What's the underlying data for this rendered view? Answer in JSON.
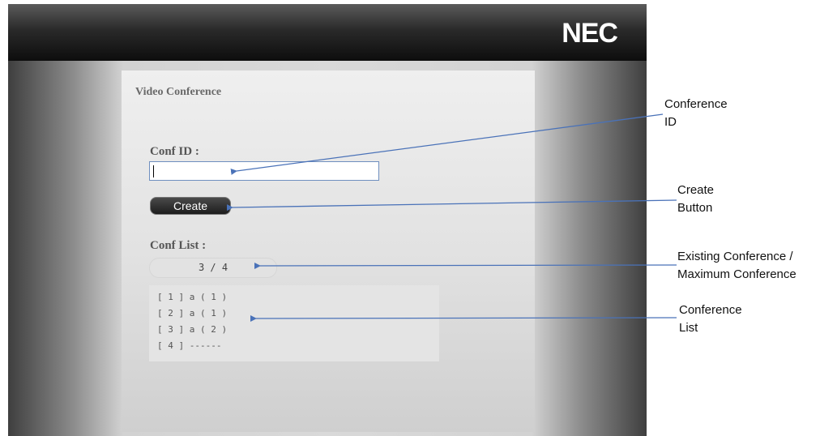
{
  "header": {
    "brand": "NEC"
  },
  "app": {
    "title": "Video Conference",
    "conf_id_label": "Conf ID :",
    "conf_id_value": "",
    "create_button": "Create",
    "conf_list_label": "Conf List :",
    "conf_count": "3 / 4",
    "conferences": [
      "[ 1 ] a ( 1 )",
      "[ 2 ] a ( 1 )",
      "[ 3 ] a ( 2 )",
      "[ 4 ] ------"
    ]
  },
  "annotations": {
    "conference_id": {
      "line1": "Conference",
      "line2": "ID"
    },
    "create_button": {
      "line1": "Create",
      "line2": "Button"
    },
    "count": {
      "line1": "Existing Conference /",
      "line2": "Maximum Conference"
    },
    "list": {
      "line1": "Conference",
      "line2": "List"
    }
  },
  "colors": {
    "arrow": "#4a72b8",
    "topbar": "#1a1a1a"
  }
}
